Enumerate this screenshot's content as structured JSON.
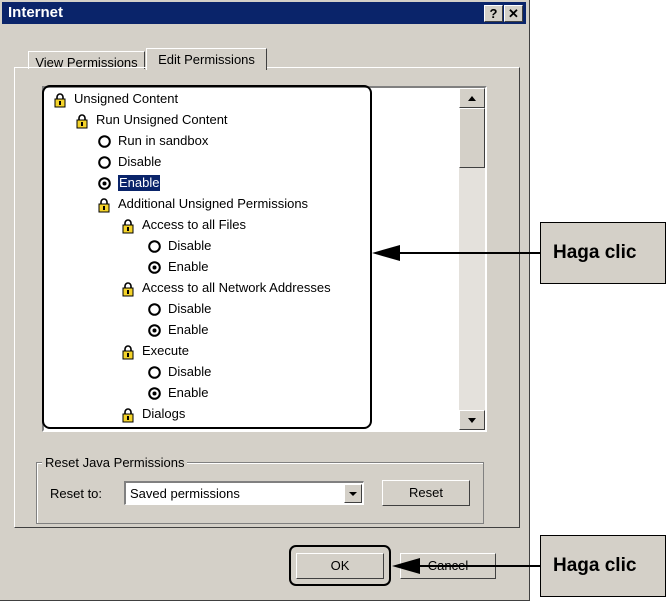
{
  "window": {
    "title": "Internet"
  },
  "tabs": [
    {
      "label": "View Permissions"
    },
    {
      "label": "Edit Permissions"
    }
  ],
  "tree": [
    {
      "label": "Unsigned Content",
      "icon": "lock-icon"
    },
    {
      "label": "Run Unsigned Content",
      "icon": "lock-icon"
    },
    {
      "label": "Run in sandbox",
      "icon": "radio"
    },
    {
      "label": "Disable",
      "icon": "radio"
    },
    {
      "label": "Enable",
      "icon": "radio-checked"
    },
    {
      "label": "Additional Unsigned Permissions",
      "icon": "lock-icon"
    },
    {
      "label": "Access to all Files",
      "icon": "lock-icon"
    },
    {
      "label": "Disable",
      "icon": "radio"
    },
    {
      "label": "Enable",
      "icon": "radio-checked"
    },
    {
      "label": "Access to all Network Addresses",
      "icon": "lock-icon"
    },
    {
      "label": "Disable",
      "icon": "radio"
    },
    {
      "label": "Enable",
      "icon": "radio-checked"
    },
    {
      "label": "Execute",
      "icon": "lock-icon"
    },
    {
      "label": "Disable",
      "icon": "radio"
    },
    {
      "label": "Enable",
      "icon": "radio-checked"
    },
    {
      "label": "Dialogs",
      "icon": "lock-icon"
    }
  ],
  "reset_group": {
    "title": "Reset Java Permissions",
    "reset_to_label": "Reset to:",
    "selected": "Saved permissions",
    "reset_button": "Reset"
  },
  "buttons": {
    "ok": "OK",
    "cancel": "Cancel"
  },
  "callouts": {
    "top": "Haga clic",
    "bottom": "Haga clic"
  },
  "colors": {
    "titlebar": "#0a246a",
    "face": "#d4d0c8",
    "selection": "#0a246a"
  }
}
